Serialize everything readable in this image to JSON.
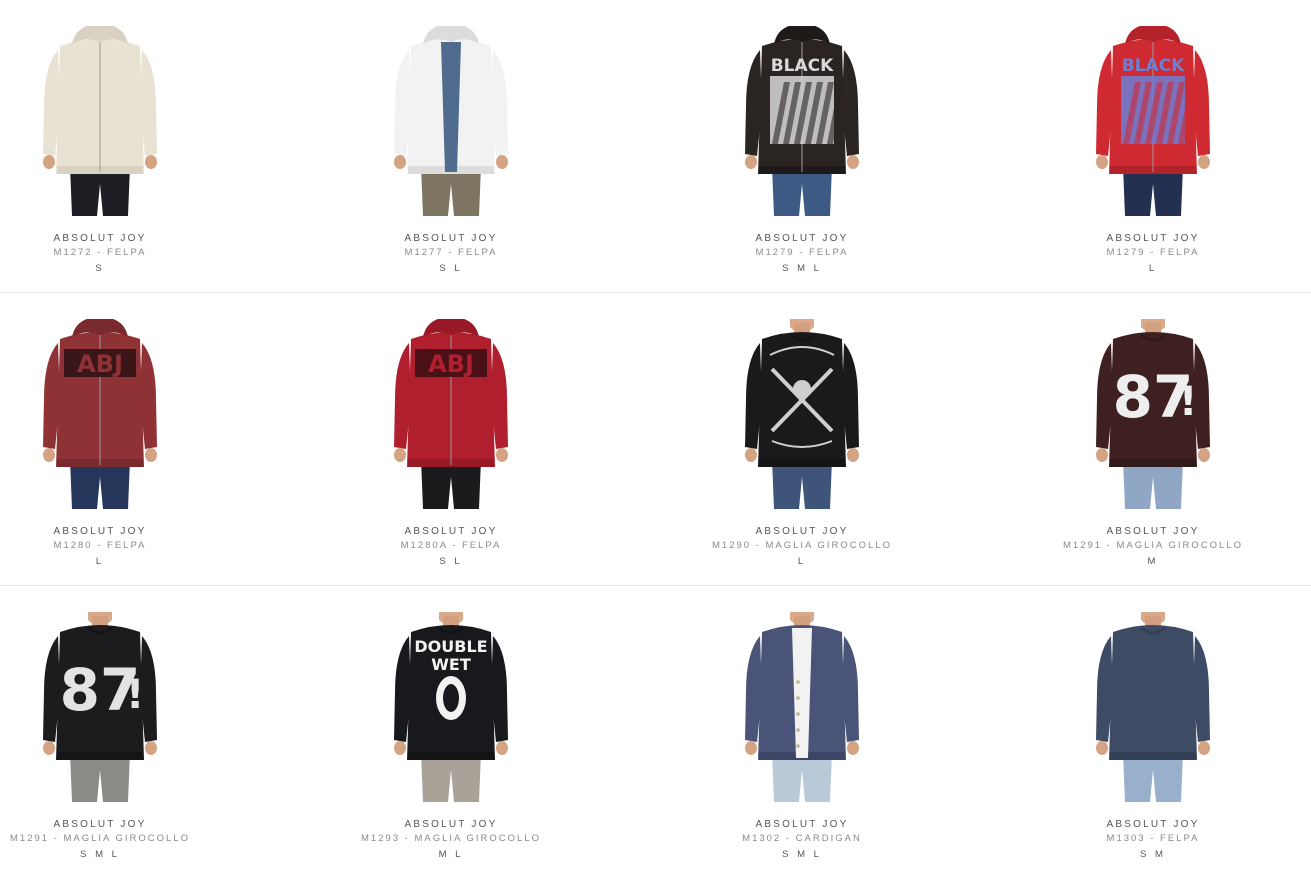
{
  "products": [
    {
      "brand": "ABSOLUT JOY",
      "model": "M1272 - FELPA",
      "sizes": "S",
      "garment": "hoodie",
      "colors": {
        "main": "#e8e2d3",
        "trim": "#d9d2c2",
        "pants": "#1e1f24",
        "inner": "#e8e2d3"
      }
    },
    {
      "brand": "ABSOLUT JOY",
      "model": "M1277 - FELPA",
      "sizes": "S L",
      "garment": "hoodie-open",
      "colors": {
        "main": "#f2f2f2",
        "trim": "#dcdcdc",
        "pants": "#7d7562",
        "inner": "#4f6b8e"
      }
    },
    {
      "brand": "ABSOLUT JOY",
      "model": "M1279 - FELPA",
      "sizes": "S M L",
      "garment": "hoodie",
      "graphic": "BLACK",
      "colors": {
        "main": "#2a2523",
        "trim": "#1d1a19",
        "pants": "#3d5a85",
        "inner": "#b21f2a",
        "print": "#d9d9d9"
      }
    },
    {
      "brand": "ABSOLUT JOY",
      "model": "M1279 - FELPA",
      "sizes": "L",
      "garment": "hoodie",
      "graphic": "BLACK",
      "colors": {
        "main": "#cf2a32",
        "trim": "#b4222a",
        "pants": "#23304f",
        "inner": "#cf2a32",
        "print": "#6b7fd6"
      }
    },
    {
      "brand": "ABSOLUT JOY",
      "model": "M1280 - FELPA",
      "sizes": "L",
      "garment": "hoodie",
      "graphic": "ABJ",
      "colors": {
        "main": "#8e3236",
        "trim": "#7a292d",
        "pants": "#26365a",
        "inner": "#8e3236",
        "print": "#3a1618"
      }
    },
    {
      "brand": "ABSOLUT JOY",
      "model": "M1280A - FELPA",
      "sizes": "S L",
      "garment": "hoodie",
      "graphic": "ABJ",
      "colors": {
        "main": "#b01f2e",
        "trim": "#981a27",
        "pants": "#1b1b1d",
        "inner": "#b01f2e",
        "print": "#4a1016"
      }
    },
    {
      "brand": "ABSOLUT JOY",
      "model": "M1290 - MAGLIA GIROCOLLO",
      "sizes": "L",
      "garment": "tee",
      "graphic": "skull",
      "colors": {
        "main": "#1a1a1c",
        "trim": "#141416",
        "pants": "#3e5478",
        "inner": "#1a1a1c",
        "print": "#cfcfcf"
      }
    },
    {
      "brand": "ABSOLUT JOY",
      "model": "M1291 - MAGLIA GIROCOLLO",
      "sizes": "M",
      "garment": "tee",
      "graphic": "87",
      "colors": {
        "main": "#3e2020",
        "trim": "#331a1a",
        "pants": "#8fa6c4",
        "inner": "#3e2020",
        "print": "#eeeeee"
      }
    },
    {
      "brand": "ABSOLUT JOY",
      "model": "M1291 - MAGLIA GIROCOLLO",
      "sizes": "S M L",
      "garment": "tee",
      "graphic": "87",
      "colors": {
        "main": "#1c1c1f",
        "trim": "#151517",
        "pants": "#8a8a86",
        "inner": "#1c1c1f",
        "print": "#e3e3e3"
      }
    },
    {
      "brand": "ABSOLUT JOY",
      "model": "M1293 - MAGLIA GIROCOLLO",
      "sizes": "M L",
      "garment": "tee",
      "graphic": "DOUBLE WET",
      "colors": {
        "main": "#18191c",
        "trim": "#121315",
        "pants": "#a9a298",
        "inner": "#18191c",
        "print": "#f2f2f2"
      }
    },
    {
      "brand": "ABSOLUT JOY",
      "model": "M1302 - CARDIGAN",
      "sizes": "S M L",
      "garment": "cardigan",
      "colors": {
        "main": "#4a5478",
        "trim": "#3c4566",
        "pants": "#b9c9d8",
        "inner": "#f2f2f2"
      }
    },
    {
      "brand": "ABSOLUT JOY",
      "model": "M1303 - FELPA",
      "sizes": "S M",
      "garment": "tee",
      "colors": {
        "main": "#3d4c64",
        "trim": "#334055",
        "pants": "#98b0cc",
        "inner": "#3d4c64"
      }
    }
  ]
}
